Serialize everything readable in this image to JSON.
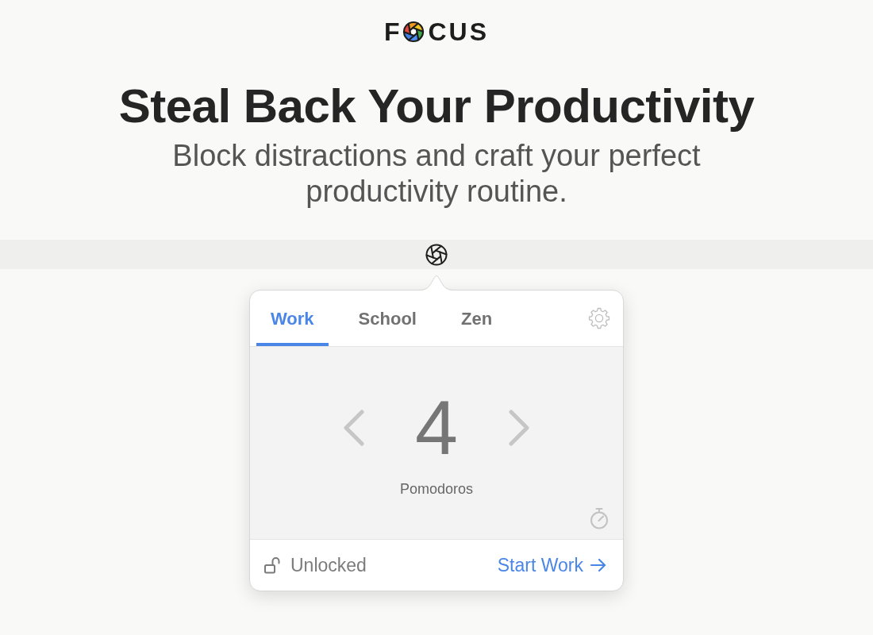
{
  "logo": {
    "text_before_mark": "F",
    "text_after_mark": "CUS"
  },
  "headline": "Steal Back Your Productivity",
  "subtitle": "Block distractions and craft your perfect productivity routine.",
  "popover": {
    "tabs": [
      {
        "label": "Work",
        "selected": true
      },
      {
        "label": "School",
        "selected": false
      },
      {
        "label": "Zen",
        "selected": false
      }
    ],
    "counter": {
      "value": "4",
      "unit": "Pomodoros"
    },
    "lock": {
      "locked": false,
      "label": "Unlocked"
    },
    "start_button": "Start Work"
  }
}
